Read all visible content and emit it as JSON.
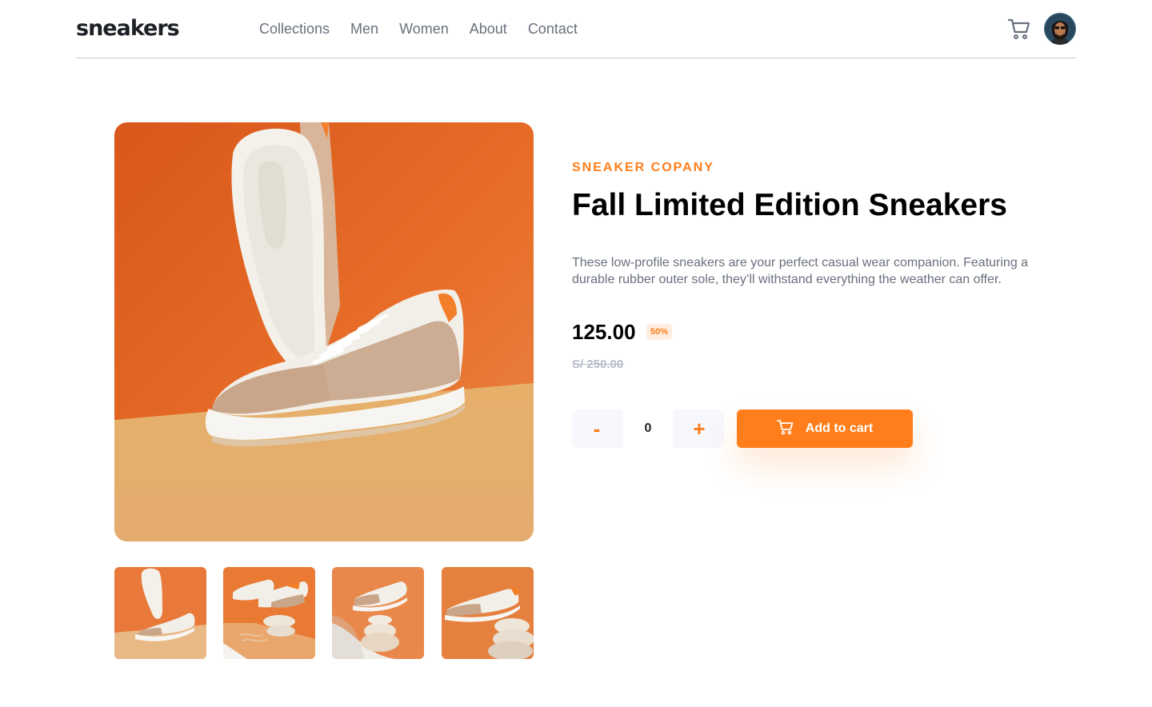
{
  "header": {
    "logo": "sneakers",
    "nav": [
      "Collections",
      "Men",
      "Women",
      "About",
      "Contact"
    ],
    "icons": {
      "cart": "cart-icon",
      "avatar": "avatar"
    }
  },
  "gallery": {
    "main": "main-product-image",
    "thumbnails": [
      "thumbnail-1",
      "thumbnail-2",
      "thumbnail-3",
      "thumbnail-4"
    ]
  },
  "product": {
    "company": "SNEAKER COPANY",
    "title": "Fall Limited Edition Sneakers",
    "description": "These low-profile sneakers are your perfect casual wear companion. Featuring a durable rubber outer sole, they’ll withstand everything the weather can offer.",
    "price": "125.00",
    "discount": "50%",
    "old_price": "S/ 250.00"
  },
  "cart_controls": {
    "minus": "-",
    "quantity": "0",
    "plus": "+",
    "add_label": "Add to cart"
  },
  "colors": {
    "accent": "#ff7e1b",
    "accent_light": "#ffede0",
    "text_dark": "#1d2026",
    "text_grey": "#69707d",
    "muted": "#b6bcc8",
    "stepper_bg": "#f6f8fd"
  }
}
